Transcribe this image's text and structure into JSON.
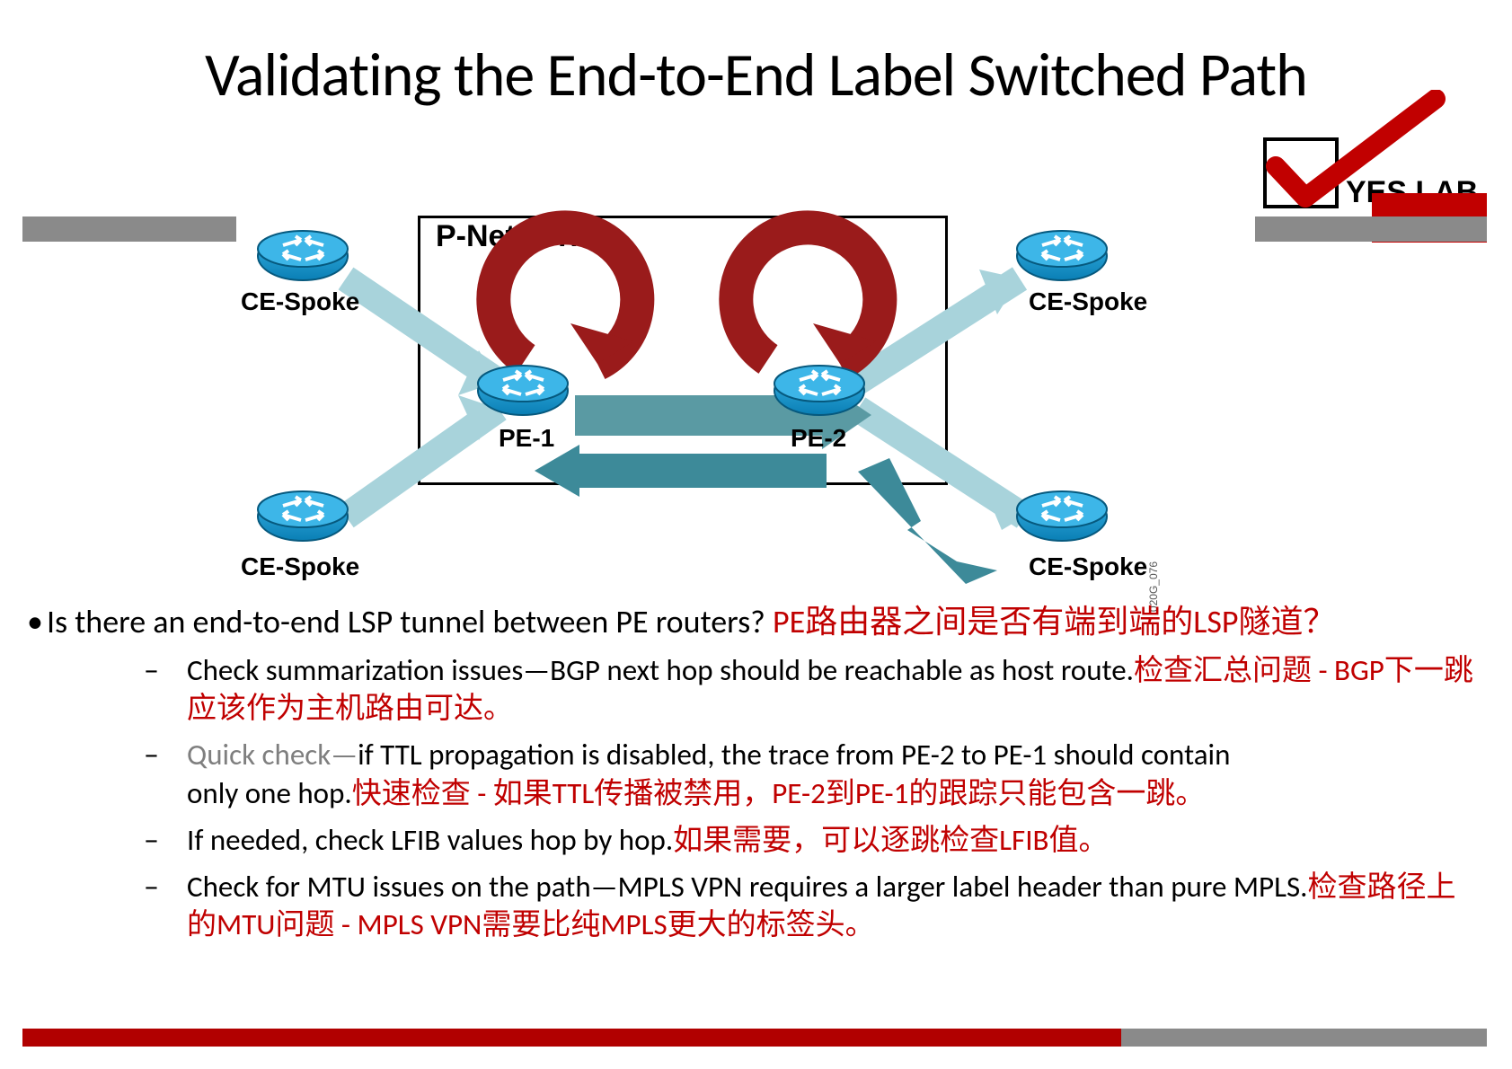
{
  "title": "Validating the End-to-End Label Switched Path",
  "logo": {
    "text": "YES LAB"
  },
  "diagram": {
    "box_label": "P-Network",
    "tl": "CE-Spoke",
    "bl": "CE-Spoke",
    "tr": "CE-Spoke",
    "br": "CE-Spoke",
    "pe1": "PE-1",
    "pe2": "PE-2",
    "code": "020G_076"
  },
  "question": {
    "en": "Is there an end-to-end LSP tunnel between PE routers?",
    "cn": "PE路由器之间是否有端到端的LSP隧道？"
  },
  "bullets": [
    {
      "en": "Check summarization issues—BGP next hop should be reachable as host route.",
      "cn": "检查汇总问题 - BGP下一跳应该作为主机路由可达。",
      "muted": false
    },
    {
      "en_a": "Quick check—",
      "en_b": "if TTL propagation is disabled, the trace from PE-2 to PE-1 should contain only one hop.",
      "cn": "快速检查 - 如果TTL传播被禁用，PE-2到PE-1的跟踪只能包含一跳。",
      "muted": true
    },
    {
      "en": "If needed, check LFIB values hop by hop.",
      "cn": "如果需要，可以逐跳检查LFIB值。",
      "muted": false
    },
    {
      "en": "Check for MTU issues on the path—MPLS VPN requires a larger label header than pure MPLS.",
      "cn": "检查路径上的MTU问题 - MPLS VPN需要比纯MPLS更大的标签头。",
      "muted": false
    }
  ]
}
